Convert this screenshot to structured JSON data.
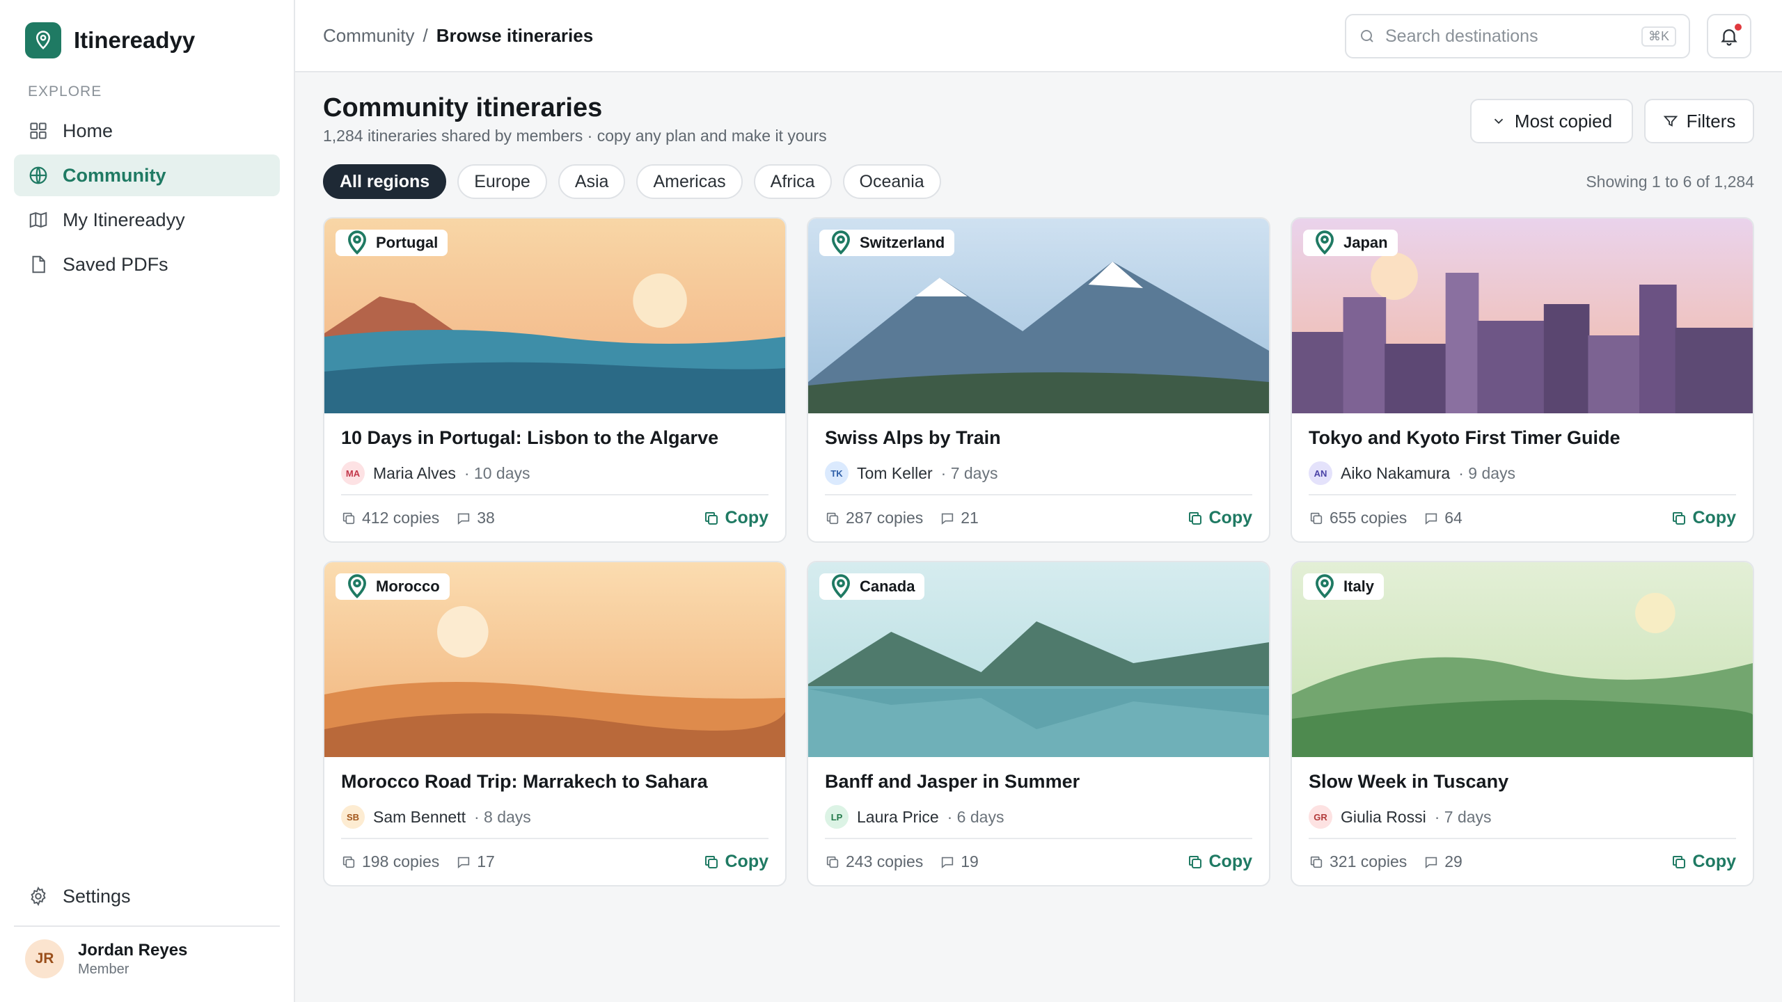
{
  "app": {
    "name": "Itinereadyy"
  },
  "sidebar": {
    "section_label": "EXPLORE",
    "items": [
      {
        "label": "Home",
        "icon": "grid-icon",
        "active": false
      },
      {
        "label": "Community",
        "icon": "globe-icon",
        "active": true
      },
      {
        "label": "My Itinereadyy",
        "icon": "map-icon",
        "active": false
      },
      {
        "label": "Saved PDFs",
        "icon": "file-icon",
        "active": false
      }
    ],
    "settings_label": "Settings",
    "user": {
      "initials": "JR",
      "name": "Jordan Reyes",
      "role": "Member"
    }
  },
  "header": {
    "breadcrumb": {
      "parent": "Community",
      "separator": "/",
      "current": "Browse itineraries"
    },
    "search": {
      "placeholder": "Search destinations",
      "shortcut": "⌘K"
    }
  },
  "main": {
    "title": "Community itineraries",
    "subtitle": "1,284 itineraries shared by members · copy any plan and make it yours",
    "sort_label": "Most copied",
    "filters_label": "Filters",
    "regions": [
      "All regions",
      "Europe",
      "Asia",
      "Americas",
      "Africa",
      "Oceania"
    ],
    "active_region": "All regions",
    "showing": "Showing 1 to 6 of 1,284",
    "copy_label": "Copy",
    "cards": [
      {
        "country": "Portugal",
        "title": "10 Days in Portugal: Lisbon to the Algarve",
        "initials": "MA",
        "author": "Maria Alves",
        "days": "· 10 days",
        "copies": "412 copies",
        "comments": "38"
      },
      {
        "country": "Switzerland",
        "title": "Swiss Alps by Train",
        "initials": "TK",
        "author": "Tom Keller",
        "days": "· 7 days",
        "copies": "287 copies",
        "comments": "21"
      },
      {
        "country": "Japan",
        "title": "Tokyo and Kyoto First Timer Guide",
        "initials": "AN",
        "author": "Aiko Nakamura",
        "days": "· 9 days",
        "copies": "655 copies",
        "comments": "64"
      },
      {
        "country": "Morocco",
        "title": "Morocco Road Trip: Marrakech to Sahara",
        "initials": "SB",
        "author": "Sam Bennett",
        "days": "· 8 days",
        "copies": "198 copies",
        "comments": "17"
      },
      {
        "country": "Canada",
        "title": "Banff and Jasper in Summer",
        "initials": "LP",
        "author": "Laura Price",
        "days": "· 6 days",
        "copies": "243 copies",
        "comments": "19"
      },
      {
        "country": "Italy",
        "title": "Slow Week in Tuscany",
        "initials": "GR",
        "author": "Giulia Rossi",
        "days": "· 7 days",
        "copies": "321 copies",
        "comments": "29"
      }
    ]
  },
  "colors": {
    "brand": "#1f7a63",
    "active_chip": "#1e2935",
    "notification": "#e0393e"
  }
}
